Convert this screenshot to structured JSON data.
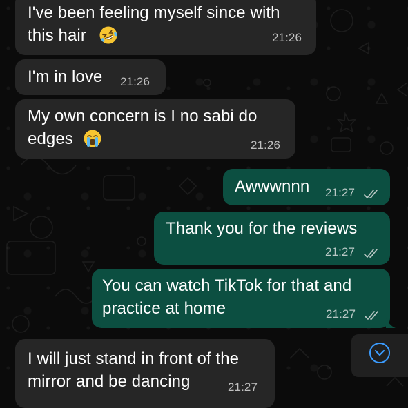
{
  "chat": {
    "messages": [
      {
        "direction": "incoming",
        "lines": [
          "I've been feeling myself since with",
          "this hair"
        ],
        "emoji": "rolling-on-floor-laughing-emoji",
        "time": "21:26"
      },
      {
        "direction": "incoming",
        "lines": [
          "I'm in love"
        ],
        "time": "21:26"
      },
      {
        "direction": "incoming",
        "lines": [
          "My own concern is I no sabi do",
          "edges"
        ],
        "emoji": "loudly-crying-emoji",
        "time": "21:26"
      },
      {
        "direction": "outgoing",
        "lines": [
          "Awwwnnn"
        ],
        "time": "21:27",
        "status": "read-double-check"
      },
      {
        "direction": "outgoing",
        "lines": [
          "Thank you for the reviews"
        ],
        "time": "21:27",
        "status": "read-double-check"
      },
      {
        "direction": "outgoing",
        "lines": [
          "You can watch TikTok for that and",
          "practice at home"
        ],
        "time": "21:27",
        "status": "read-double-check"
      },
      {
        "direction": "incoming",
        "lines": [
          "I will just stand in front of the",
          "mirror and be dancing"
        ],
        "time": "21:27"
      }
    ]
  },
  "scroll_button": {
    "icon": "chevron-down-icon"
  },
  "colors": {
    "background": "#0b0b0b",
    "incoming_bubble": "#262626",
    "outgoing_bubble": "#0c4f41",
    "accent": "#3b9cff"
  }
}
